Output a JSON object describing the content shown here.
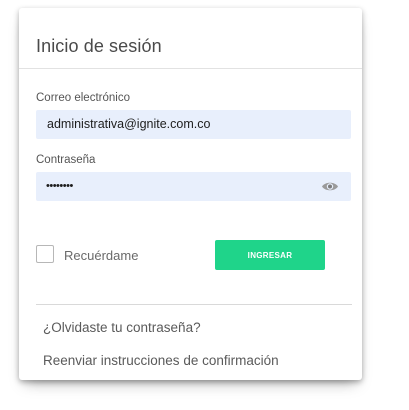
{
  "login": {
    "title": "Inicio de sesión",
    "email_label": "Correo electrónico",
    "email_value": "administrativa@ignite.com.co",
    "password_label": "Contraseña",
    "password_mask": "••••••••",
    "show_password_icon": "eye-icon",
    "remember_label": "Recuérdame",
    "remember_checked": false,
    "submit_label": "INGRESAR",
    "forgot_password_link": "¿Olvidaste tu contraseña?",
    "resend_instructions_link": "Reenviar instrucciones de confirmación"
  },
  "colors": {
    "input_background": "#e8effc",
    "submit_button": "#1fd48a"
  }
}
